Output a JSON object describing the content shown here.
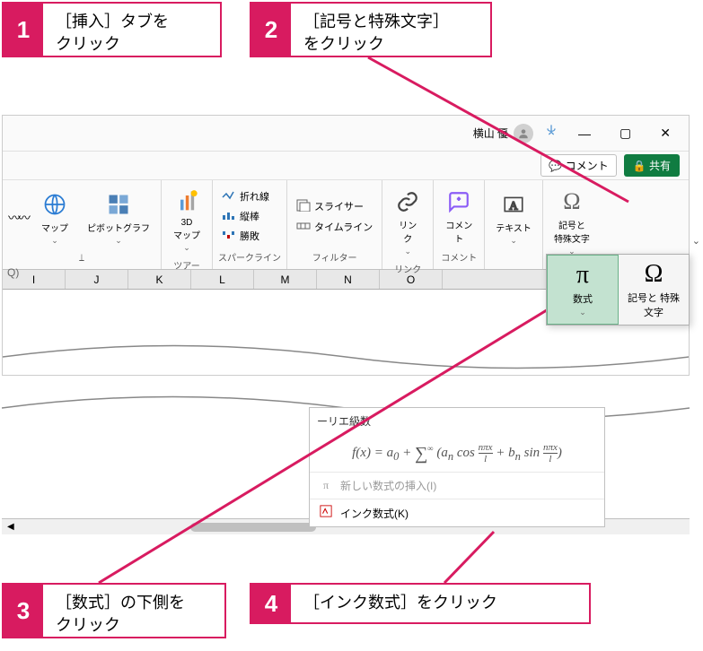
{
  "callouts": {
    "c1": {
      "num": "1",
      "text": "［挿入］タブを\nクリック"
    },
    "c2": {
      "num": "2",
      "text": "［記号と特殊文字］\nをクリック"
    },
    "c3": {
      "num": "3",
      "text": "［数式］の下側を\nクリック"
    },
    "c4": {
      "num": "4",
      "text": "［インク数式］をクリック"
    }
  },
  "titlebar": {
    "user": "横山 優",
    "search_prefix": "Q)"
  },
  "tabbar": {
    "comment": "コメント",
    "share": "共有"
  },
  "ribbon": {
    "map": "マップ",
    "pivotchart": "ピボットグラフ",
    "threedmap": "3D\nマップ",
    "tour_group": "ツアー",
    "sp_line": "折れ線",
    "sp_bar": "縦棒",
    "sp_winloss": "勝敗",
    "sparklines_group": "スパークライン",
    "slicer": "スライサー",
    "timeline": "タイムライン",
    "filter_group": "フィルター",
    "link": "リン\nク",
    "link_group": "リンク",
    "comment": "コメン\nト",
    "comment_group": "コメント",
    "text": "テキスト",
    "symbols": "記号と\n特殊文字",
    "hat": "^"
  },
  "dropdown": {
    "equation": "数式",
    "symbol": "記号と\n特殊文字",
    "pi": "π",
    "omega": "Ω"
  },
  "columns": [
    "I",
    "J",
    "K",
    "L",
    "M",
    "N",
    "O"
  ],
  "equation_panel": {
    "title": "ーリエ級数",
    "insert_new": "新しい数式の挿入(I)",
    "ink_equation": "インク数式(K)"
  }
}
